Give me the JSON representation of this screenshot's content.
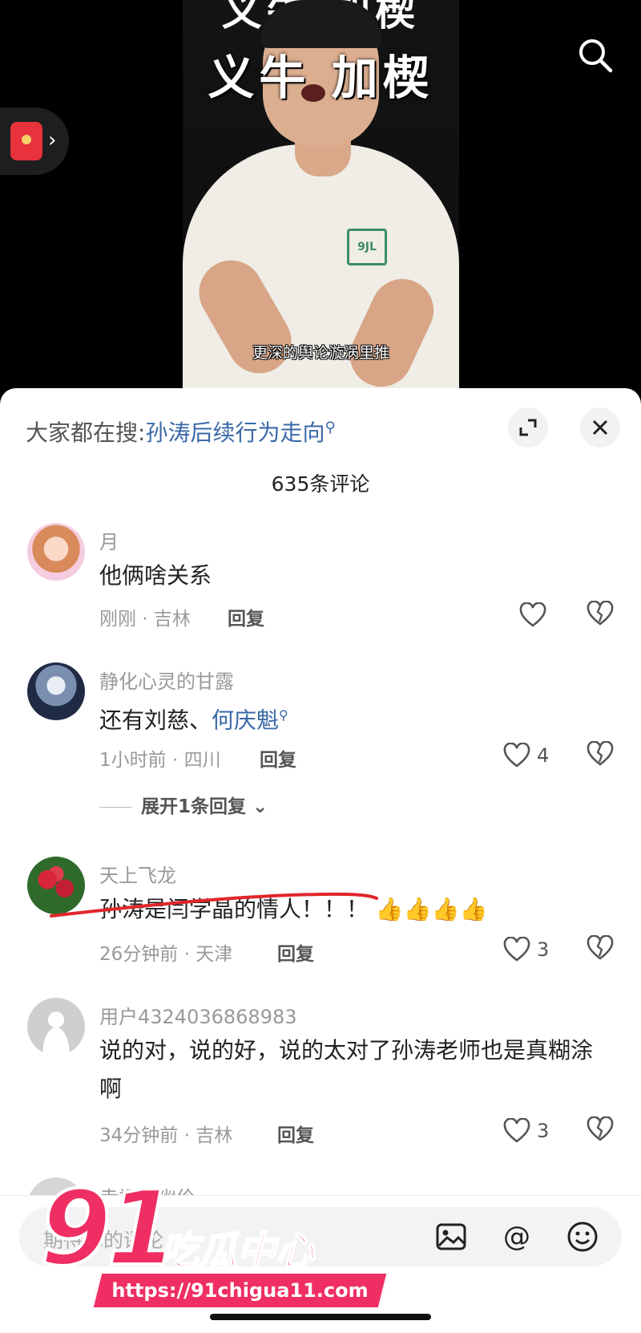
{
  "video": {
    "title_overlay": "义牛  加楔",
    "subtitle": "更深的舆论漩涡里推",
    "shirt_logo": "9JL"
  },
  "icons": {
    "top_search": "search-icon",
    "red_packet": "red-packet-icon",
    "expand": "expand-icon",
    "close": "close-icon",
    "like": "heart-icon",
    "dislike": "broken-heart-icon",
    "image": "image-icon",
    "mention": "at-icon",
    "emoji": "emoji-icon"
  },
  "sheet": {
    "search_prefix": "大家都在搜:",
    "search_hot": "孙涛后续行为走向",
    "comment_count": "635条评论"
  },
  "comments": [
    {
      "user": "月",
      "text": "他俩啥关系",
      "time_loc": "刚刚 · 吉林",
      "reply": "回复",
      "likes": ""
    },
    {
      "user": "静化心灵的甘露",
      "text_pre": "还有刘慈、",
      "text_kw": "何庆魁",
      "time_loc": "1小时前 · 四川",
      "reply": "回复",
      "likes": "4",
      "expand": "展开1条回复"
    },
    {
      "user": "天上飞龙",
      "text": "孙涛是闫学晶的情人！！！ 👍👍👍👍",
      "time_loc": "26分钟前 · 天津",
      "reply": "回复",
      "likes": "3"
    },
    {
      "user": "用户4324036868983",
      "text": "说的对，说的好，说的太对了孙涛老师也是真糊涂啊",
      "time_loc": "34分钟前 · 吉林",
      "reply": "回复",
      "likes": "3"
    },
    {
      "user": "幸福好幽伶"
    }
  ],
  "input": {
    "placeholder": "期待你的评论"
  },
  "watermark": {
    "num": "91",
    "cn": "吃瓜中心",
    "url": "https://91chigua11.com"
  },
  "colors": {
    "link": "#3a68a8",
    "watermark": "#ef2f63",
    "underline": "#e0262b"
  }
}
